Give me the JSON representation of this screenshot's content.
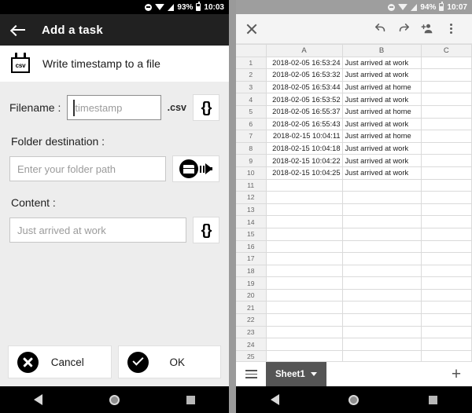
{
  "left_phone": {
    "status_bar": {
      "battery": "93%",
      "time": "10:03",
      "icons": [
        "dnd-icon",
        "wifi-icon",
        "signal-icon",
        "battery-icon"
      ]
    },
    "app_bar": {
      "back_icon": "back-arrow-icon",
      "title": "Add a task"
    },
    "task_header": {
      "icon": "csv-file-icon",
      "icon_text": "csv",
      "label": "Write timestamp to a file"
    },
    "form": {
      "filename_label": "Filename :",
      "filename_value": "",
      "filename_placeholder": "timestamp",
      "filename_suffix": ".csv",
      "filename_variable_button": "{}",
      "folder_label": "Folder destination :",
      "folder_value": "",
      "folder_placeholder": "Enter your folder path",
      "folder_picker_icon": "folder-picker-icon",
      "content_label": "Content :",
      "content_value": "",
      "content_placeholder": "Just arrived at work",
      "content_variable_button": "{}"
    },
    "actions": {
      "cancel_label": "Cancel",
      "cancel_icon": "cancel-circle-icon",
      "ok_label": "OK",
      "ok_icon": "check-circle-icon"
    },
    "nav_bar": {
      "back": "nav-back-icon",
      "home": "nav-home-icon",
      "recents": "nav-recents-icon"
    }
  },
  "right_phone": {
    "status_bar": {
      "battery": "94%",
      "time": "10:07",
      "icons": [
        "dnd-icon",
        "wifi-icon",
        "signal-icon",
        "battery-icon"
      ]
    },
    "toolbar": {
      "close_icon": "close-icon",
      "undo_icon": "undo-icon",
      "redo_icon": "redo-icon",
      "share_icon": "add-person-icon",
      "overflow_icon": "overflow-menu-icon"
    },
    "spreadsheet": {
      "columns": [
        "A",
        "B",
        "C"
      ],
      "rows": [
        {
          "n": "1",
          "a": "2018-02-05 16:53:24",
          "b": "Just arrived at work",
          "c": ""
        },
        {
          "n": "2",
          "a": "2018-02-05 16:53:32",
          "b": "Just arrived at work",
          "c": ""
        },
        {
          "n": "3",
          "a": "2018-02-05 16:53:44",
          "b": "Just arrived at home",
          "c": ""
        },
        {
          "n": "4",
          "a": "2018-02-05 16:53:52",
          "b": "Just arrived at work",
          "c": ""
        },
        {
          "n": "5",
          "a": "2018-02-05 16:55:37",
          "b": "Just arrived at home",
          "c": ""
        },
        {
          "n": "6",
          "a": "2018-02-05 16:55:43",
          "b": "Just arrived at work",
          "c": ""
        },
        {
          "n": "7",
          "a": "2018-02-15 10:04:11",
          "b": "Just arrived at home",
          "c": ""
        },
        {
          "n": "8",
          "a": "2018-02-15 10:04:18",
          "b": "Just arrived at work",
          "c": ""
        },
        {
          "n": "9",
          "a": "2018-02-15 10:04:22",
          "b": "Just arrived at work",
          "c": ""
        },
        {
          "n": "10",
          "a": "2018-02-15 10:04:25",
          "b": "Just arrived at work",
          "c": ""
        },
        {
          "n": "11",
          "a": "",
          "b": "",
          "c": ""
        },
        {
          "n": "12",
          "a": "",
          "b": "",
          "c": ""
        },
        {
          "n": "13",
          "a": "",
          "b": "",
          "c": ""
        },
        {
          "n": "14",
          "a": "",
          "b": "",
          "c": ""
        },
        {
          "n": "15",
          "a": "",
          "b": "",
          "c": ""
        },
        {
          "n": "16",
          "a": "",
          "b": "",
          "c": ""
        },
        {
          "n": "17",
          "a": "",
          "b": "",
          "c": ""
        },
        {
          "n": "18",
          "a": "",
          "b": "",
          "c": ""
        },
        {
          "n": "19",
          "a": "",
          "b": "",
          "c": ""
        },
        {
          "n": "20",
          "a": "",
          "b": "",
          "c": ""
        },
        {
          "n": "21",
          "a": "",
          "b": "",
          "c": ""
        },
        {
          "n": "22",
          "a": "",
          "b": "",
          "c": ""
        },
        {
          "n": "23",
          "a": "",
          "b": "",
          "c": ""
        },
        {
          "n": "24",
          "a": "",
          "b": "",
          "c": ""
        },
        {
          "n": "25",
          "a": "",
          "b": "",
          "c": ""
        }
      ]
    },
    "sheet_bar": {
      "menu_icon": "sheet-list-icon",
      "tab_label": "Sheet1",
      "tab_caret": "chevron-down-icon",
      "add_label": "+"
    },
    "nav_bar": {
      "back": "nav-back-icon",
      "home": "nav-home-icon",
      "recents": "nav-recents-icon"
    }
  },
  "colors": {
    "app_bar": "#212121",
    "page_bg": "#ededed",
    "sheet_tab": "#555555",
    "status_gray": "#9e9e9e"
  }
}
